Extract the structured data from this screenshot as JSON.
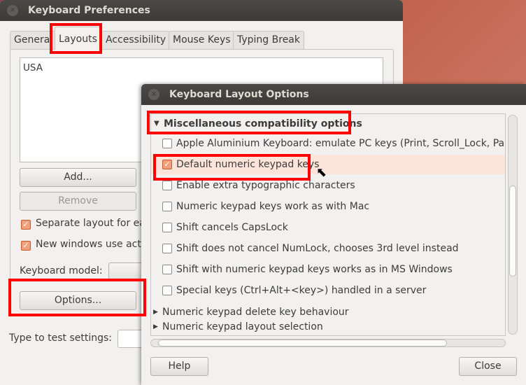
{
  "main_window": {
    "title": "Keyboard Preferences",
    "tabs": [
      {
        "label": "General"
      },
      {
        "label": "Layouts",
        "active": true
      },
      {
        "label": "Accessibility"
      },
      {
        "label": "Mouse Keys"
      },
      {
        "label": "Typing Break"
      }
    ],
    "layouts": [
      "USA"
    ],
    "add_label": "Add...",
    "remove_label": "Remove",
    "checkboxes": [
      {
        "label": "Separate layout for ea",
        "checked": true
      },
      {
        "label": "New windows use activ",
        "checked": true
      }
    ],
    "keyboard_model_label": "Keyboard model:",
    "options_label": "Options...",
    "test_label": "Type to test settings:",
    "test_value": ""
  },
  "dialog": {
    "title": "Keyboard Layout Options",
    "group": {
      "label": "Miscellaneous compatibility options",
      "expanded": true
    },
    "options": [
      {
        "label": "Apple Aluminium Keyboard: emulate PC keys (Print, Scroll_Lock, Pause",
        "checked": false
      },
      {
        "label": "Default numeric keypad keys",
        "checked": true
      },
      {
        "label": "Enable extra typographic characters",
        "checked": false
      },
      {
        "label": "Numeric keypad keys work as with Mac",
        "checked": false
      },
      {
        "label": "Shift cancels CapsLock",
        "checked": false
      },
      {
        "label": "Shift does not cancel NumLock, chooses 3rd level instead",
        "checked": false
      },
      {
        "label": "Shift with numeric keypad keys works as in MS Windows",
        "checked": false
      },
      {
        "label": "Special keys (Ctrl+Alt+<key>) handled in a server",
        "checked": false
      }
    ],
    "collapsed_groups": [
      {
        "label": "Numeric keypad delete key behaviour"
      },
      {
        "label": "Numeric keypad layout selection"
      }
    ],
    "help_label": "Help",
    "close_label": "Close"
  },
  "colors": {
    "highlight": "#ff0000",
    "titlebar": "#3c3b37",
    "selected_row": "#fde4da",
    "check_accent": "#f0a07a"
  }
}
